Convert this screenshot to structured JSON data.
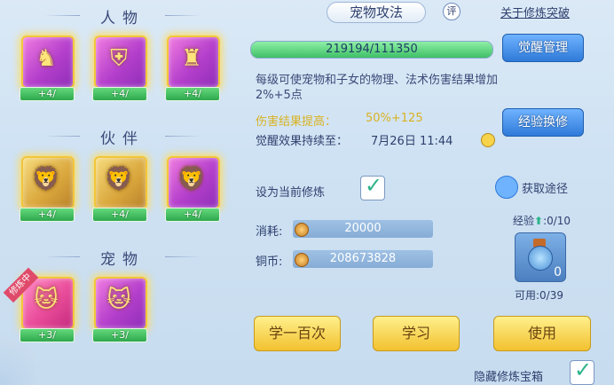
{
  "left": {
    "sections": [
      {
        "title": "人物",
        "cards": [
          {
            "icon": "figure-icon",
            "level": "+4/"
          },
          {
            "icon": "armor-icon",
            "level": "+4/"
          },
          {
            "icon": "warrior-icon",
            "level": "+4/"
          }
        ]
      },
      {
        "title": "伙伴",
        "cards": [
          {
            "icon": "lion-sword-icon",
            "level": "+4/"
          },
          {
            "icon": "lion-armor-icon",
            "level": "+4/"
          },
          {
            "icon": "lion-staff-icon",
            "level": "+4/"
          }
        ]
      },
      {
        "title": "宠物",
        "cards": [
          {
            "icon": "pet-cat-sword-icon",
            "level": "+3/",
            "badge": "修炼中"
          },
          {
            "icon": "pet-cat-shield-icon",
            "level": "+3/"
          }
        ]
      }
    ]
  },
  "right": {
    "tab": "宠物攻法",
    "ping": "评",
    "breakthrough_link": "关于修炼突破",
    "progress": {
      "text": "219194/111350",
      "fraction": 1.0
    },
    "awaken_button": "觉醒管理",
    "description": "每级可使宠物和子女的物理、法术伤害结果增加2%+5点",
    "damage_label": "伤害结果提高：",
    "damage_value": "50%+125",
    "awaken_label": "觉醒效果持续至：",
    "awaken_date": "7月26日 11:44",
    "exchange_button": "经验换修",
    "set_current_label": "设为当前修炼",
    "get_path": "获取途径",
    "cost_label": "消耗:",
    "cost_value": "20000",
    "coin_label": "铜币:",
    "coin_value": "208673828",
    "exp_label": "经验",
    "exp_count": ":0/10",
    "exp_box_value": "0",
    "usable": "可用:0/39",
    "learn100": "学一百次",
    "learn": "学习",
    "use": "使用",
    "hide_box": "隐藏修炼宝箱"
  },
  "colors": {
    "accent_blue": "#2f7ad9",
    "yellow": "#f2c12f",
    "purple": "#b43fcc",
    "gold": "#d9a63c",
    "green": "#3fbf66"
  }
}
